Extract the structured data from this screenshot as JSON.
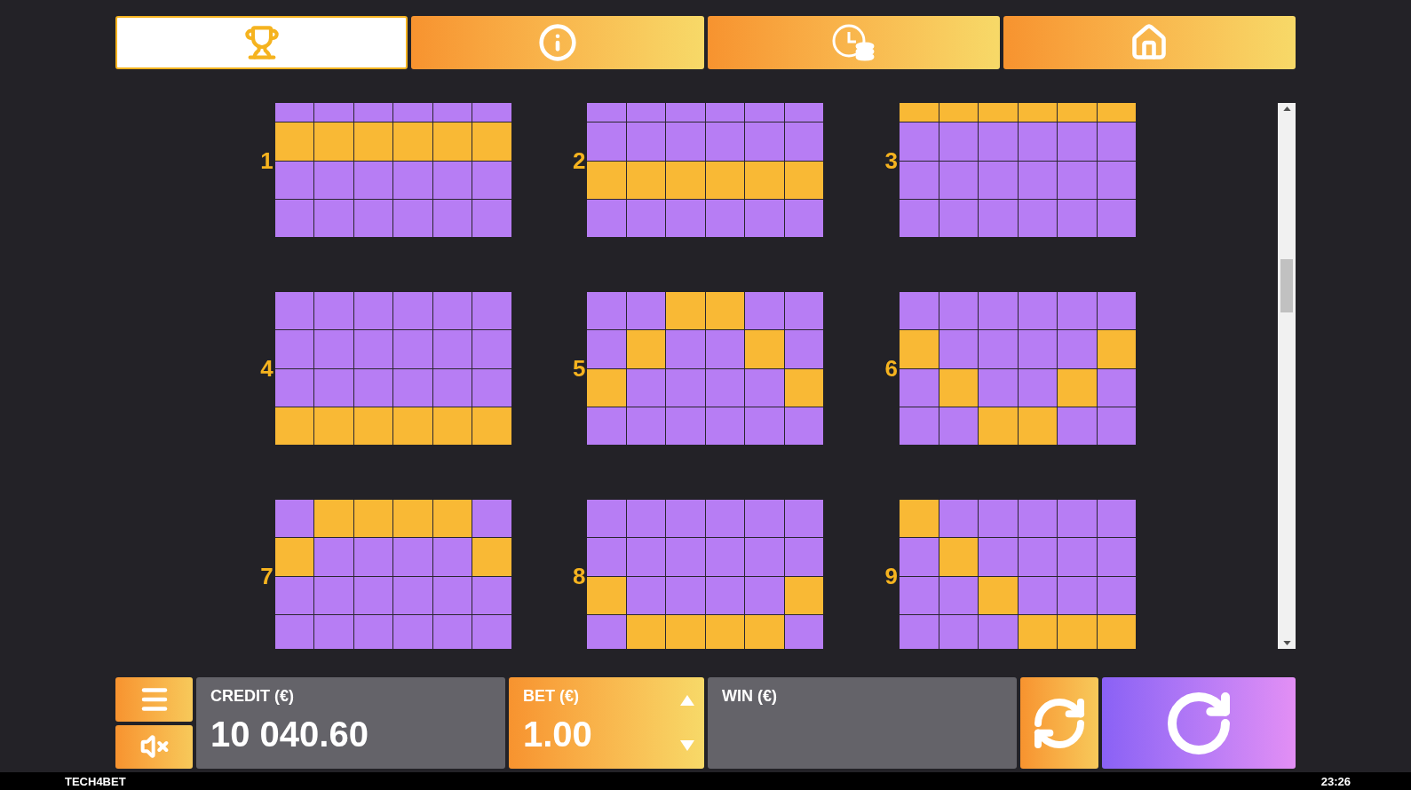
{
  "tabs": [
    {
      "kind": "trophy",
      "selected": true
    },
    {
      "kind": "info",
      "selected": false
    },
    {
      "kind": "history",
      "selected": false
    },
    {
      "kind": "home",
      "selected": false
    }
  ],
  "paylines": [
    {
      "number": "1",
      "rows": [
        [
          false,
          false,
          false,
          false,
          false,
          false
        ],
        [
          true,
          true,
          true,
          true,
          true,
          true
        ],
        [
          false,
          false,
          false,
          false,
          false,
          false
        ],
        [
          false,
          false,
          false,
          false,
          false,
          false
        ]
      ]
    },
    {
      "number": "2",
      "rows": [
        [
          false,
          false,
          false,
          false,
          false,
          false
        ],
        [
          false,
          false,
          false,
          false,
          false,
          false
        ],
        [
          true,
          true,
          true,
          true,
          true,
          true
        ],
        [
          false,
          false,
          false,
          false,
          false,
          false
        ]
      ]
    },
    {
      "number": "3",
      "rows": [
        [
          true,
          true,
          true,
          true,
          true,
          true
        ],
        [
          false,
          false,
          false,
          false,
          false,
          false
        ],
        [
          false,
          false,
          false,
          false,
          false,
          false
        ],
        [
          false,
          false,
          false,
          false,
          false,
          false
        ]
      ]
    },
    {
      "number": "4",
      "rows": [
        [
          false,
          false,
          false,
          false,
          false,
          false
        ],
        [
          false,
          false,
          false,
          false,
          false,
          false
        ],
        [
          false,
          false,
          false,
          false,
          false,
          false
        ],
        [
          true,
          true,
          true,
          true,
          true,
          true
        ]
      ]
    },
    {
      "number": "5",
      "rows": [
        [
          false,
          false,
          true,
          true,
          false,
          false
        ],
        [
          false,
          true,
          false,
          false,
          true,
          false
        ],
        [
          true,
          false,
          false,
          false,
          false,
          true
        ],
        [
          false,
          false,
          false,
          false,
          false,
          false
        ]
      ]
    },
    {
      "number": "6",
      "rows": [
        [
          false,
          false,
          false,
          false,
          false,
          false
        ],
        [
          true,
          false,
          false,
          false,
          false,
          true
        ],
        [
          false,
          true,
          false,
          false,
          true,
          false
        ],
        [
          false,
          false,
          true,
          true,
          false,
          false
        ]
      ]
    },
    {
      "number": "7",
      "rows": [
        [
          false,
          true,
          true,
          true,
          true,
          false
        ],
        [
          true,
          false,
          false,
          false,
          false,
          true
        ],
        [
          false,
          false,
          false,
          false,
          false,
          false
        ],
        [
          false,
          false,
          false,
          false,
          false,
          false
        ]
      ]
    },
    {
      "number": "8",
      "rows": [
        [
          false,
          false,
          false,
          false,
          false,
          false
        ],
        [
          false,
          false,
          false,
          false,
          false,
          false
        ],
        [
          true,
          false,
          false,
          false,
          false,
          true
        ],
        [
          false,
          true,
          true,
          true,
          true,
          false
        ]
      ]
    },
    {
      "number": "9",
      "rows": [
        [
          true,
          false,
          false,
          false,
          false,
          false
        ],
        [
          false,
          true,
          false,
          false,
          false,
          false
        ],
        [
          false,
          false,
          true,
          false,
          false,
          false
        ],
        [
          false,
          false,
          false,
          true,
          true,
          true
        ]
      ]
    }
  ],
  "credit": {
    "label": "CREDIT (€)",
    "value": "10 040.60"
  },
  "bet": {
    "label": "BET (€)",
    "value": "1.00"
  },
  "win": {
    "label": "WIN (€)"
  },
  "status_bar": {
    "left": "TECH4BET",
    "right": "23:26"
  }
}
